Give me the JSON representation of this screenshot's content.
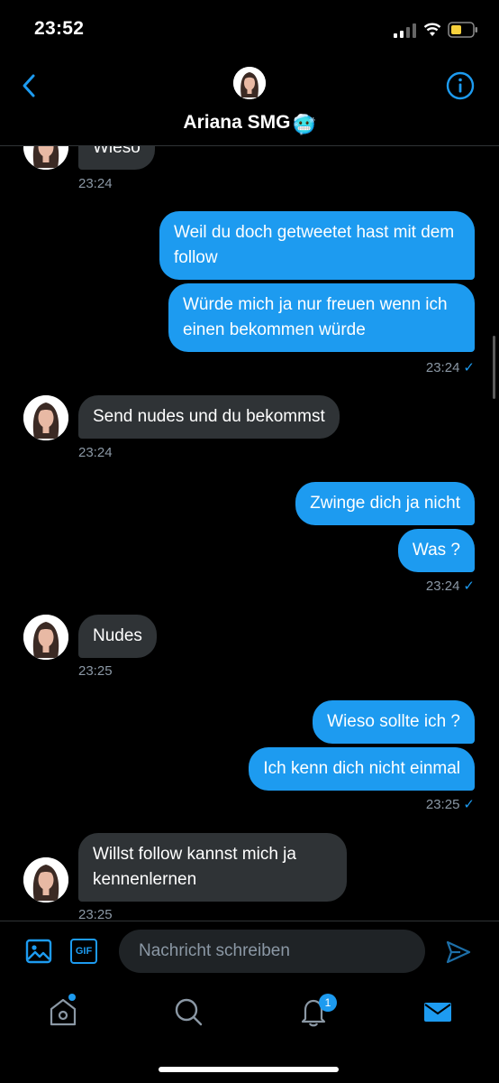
{
  "status_bar": {
    "time": "23:52"
  },
  "header": {
    "contact_name": "Ariana SMG",
    "contact_emoji": "🥶"
  },
  "messages": [
    {
      "side": "in",
      "text": "Wieso"
    },
    {
      "side": "in_ts",
      "time": "23:24"
    },
    {
      "side": "out",
      "text": "Weil du doch getweetet hast mit dem follow"
    },
    {
      "side": "out",
      "text": "Würde mich ja nur freuen wenn ich einen bekommen würde"
    },
    {
      "side": "out_ts",
      "time": "23:24"
    },
    {
      "side": "in",
      "text": "Send nudes und du bekommst"
    },
    {
      "side": "in_ts",
      "time": "23:24"
    },
    {
      "side": "out",
      "text": "Zwinge dich ja nicht"
    },
    {
      "side": "out",
      "text": "Was ?"
    },
    {
      "side": "out_ts",
      "time": "23:24"
    },
    {
      "side": "in",
      "text": "Nudes"
    },
    {
      "side": "in_ts",
      "time": "23:25"
    },
    {
      "side": "out",
      "text": "Wieso sollte ich ?"
    },
    {
      "side": "out",
      "text": "Ich kenn dich nicht einmal"
    },
    {
      "side": "out_ts",
      "time": "23:25"
    },
    {
      "side": "in",
      "text": "Willst follow kannst mich ja kennenlernen"
    },
    {
      "side": "in_ts",
      "time": "23:25"
    }
  ],
  "composer": {
    "placeholder": "Nachricht schreiben",
    "gif_label": "GIF"
  },
  "nav": {
    "notifications_badge": "1"
  },
  "colors": {
    "accent": "#1d9bf0",
    "incoming_bubble": "#2f3336",
    "background": "#000000"
  },
  "icons": [
    "back-chevron-icon",
    "info-icon",
    "image-icon",
    "gif-icon",
    "send-icon",
    "home-icon",
    "search-icon",
    "bell-icon",
    "mail-icon"
  ]
}
